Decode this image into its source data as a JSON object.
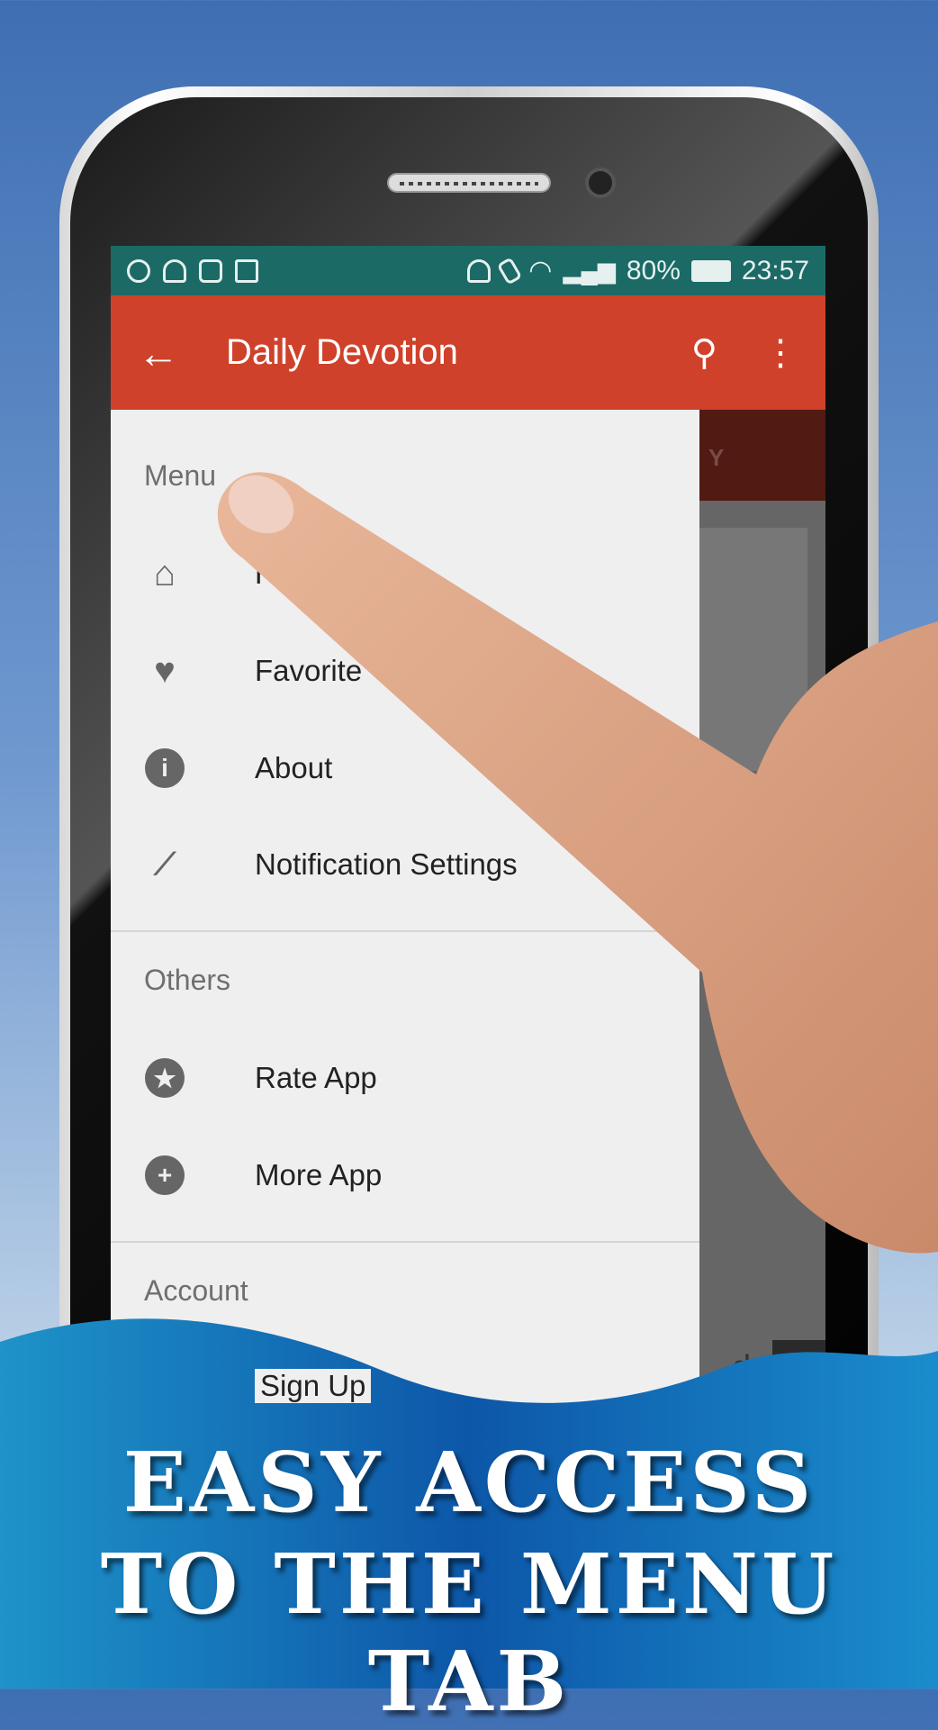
{
  "status_bar": {
    "battery": "80%",
    "time": "23:57",
    "left_icons": [
      "whatsapp-icon",
      "headset-icon",
      "image-icon",
      "gmail-icon"
    ],
    "right_icons": [
      "headphones-icon",
      "vibrate-icon",
      "wifi-icon",
      "signal-icon",
      "battery-icon"
    ]
  },
  "toolbar": {
    "title": "Daily Devotion",
    "back_icon": "arrow-left-icon",
    "search_icon": "search-icon",
    "more_icon": "more-vert-icon",
    "color": "#cf412a"
  },
  "tabs": {
    "partial_label": "Y"
  },
  "drawer": {
    "sections": [
      {
        "title": "Menu",
        "items": [
          {
            "label": "Home",
            "icon": "home-icon"
          },
          {
            "label": "Favorite",
            "icon": "heart-icon"
          },
          {
            "label": "About",
            "icon": "info-icon"
          },
          {
            "label": "Notification Settings",
            "icon": "brush-icon"
          }
        ]
      },
      {
        "title": "Others",
        "items": [
          {
            "label": "Rate App",
            "icon": "star-icon"
          },
          {
            "label": "More App",
            "icon": "plus-icon"
          }
        ]
      },
      {
        "title": "Account",
        "items": [
          {
            "label": "Sign Up",
            "icon": "person-icon"
          }
        ]
      }
    ]
  },
  "background_partial_text": "do",
  "caption": {
    "line1": "EASY ACCESS",
    "line2": "TO THE MENU TAB"
  }
}
